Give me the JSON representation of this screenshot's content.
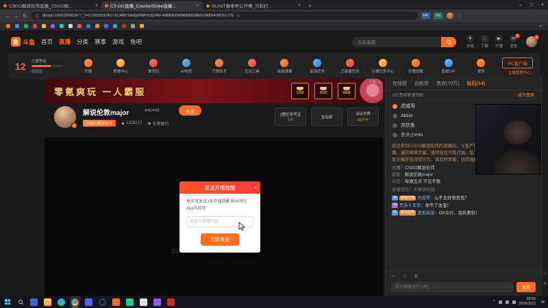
{
  "glyphs": {
    "close": "×",
    "minimize": "–",
    "maximize": "□",
    "new_tab": "+",
    "back": "←",
    "forward": "→",
    "refresh": "↻",
    "menu": "⋮",
    "star": "☆",
    "secure": "ⓘ",
    "more": "»",
    "chevron_up": "^",
    "gear": "⚙",
    "smile": "☺",
    "check": "✓",
    "diamond": "◆",
    "mail": "✉",
    "download": "↓",
    "yuan": "¥",
    "play": "▶",
    "dot": "●",
    "shield": "◉",
    "plus": "+"
  },
  "browser": {
    "tabs": [
      {
        "label": "CSGO解说伦伟直播_CSGO解…"
      },
      {
        "label": "CS:GO直播_CounterStrike直播…"
      },
      {
        "label": "BLAST春季杯公开赛_贝彩打…"
      }
    ],
    "url": "douyu.com/2938297?_r=0.55555324273134978&dyshid=532348-e9db83568edd325bdcc6dfa400051701",
    "ext1": "HK",
    "ext2": "5G"
  },
  "douyu": {
    "nav": {
      "logo_box": "鱼",
      "logo_text": "斗鱼",
      "items": [
        "首页",
        "直播",
        "分类",
        "赛事",
        "游戏",
        "鱼吧"
      ],
      "search_text": "去买蛋糕",
      "quick": [
        {
          "label": "充值"
        },
        {
          "label": "下载"
        },
        {
          "label": "开播"
        },
        {
          "label": "消息",
          "badge": "2"
        }
      ],
      "avatar_badge": "2"
    },
    "toolbar": {
      "level": "12",
      "level_label": "主播等级",
      "exp_label": "经验值",
      "items": [
        "开播",
        "数据中心",
        "推流码",
        "AI电竞",
        "刀塔助手",
        "互动工具",
        "高能弹幕",
        "星海任务",
        "正能量任务",
        "主播任务中心",
        "开播提醒",
        "鱼翅VIP",
        "更多"
      ],
      "pc_client": "PC客户端",
      "manage": "主播管理中心 ›"
    },
    "banner": {
      "slogan": "零氪爽玩 一人霸服",
      "ad_tag": "广告",
      "prices": [
        "1300",
        "4500",
        "8888"
      ]
    },
    "streamer": {
      "name": "解说伦敦major",
      "followers": "640449",
      "follow": "关注",
      "fan_badge": "CSGO解说伦伟",
      "room_id": "1326217",
      "tag": "无需解约",
      "task1_line1": "2图任务凭证",
      "task1_line2": "1/5",
      "horn": "全站晒",
      "trial_line1": "试玩世界",
      "trial_line2": "20分卡"
    },
    "video_hint": "您当前未开播，开播后这里将显示直播画面",
    "modal": {
      "title": "发送开播提醒",
      "desc": "每天可发送3条开播提醒,粉丝将在App内收到",
      "input_placeholder": "自定义提醒内容",
      "submit": "立即发送"
    },
    "sidebar": {
      "tabs": [
        "在线榜",
        "远航榜",
        "贵宾(70万)",
        "钻石(14)"
      ],
      "notice": "8位贵宾尊享特权",
      "notice_link": "成为贵宾",
      "users": [
        "虎威哥",
        "Aktus",
        "苏钦鱼",
        "东大小miu"
      ],
      "welcome": "欢迎来到CSGO解说伦伟的直播间，斗鱼严禁未成年人充值打赏。绿色直播，谨防网络诈骗，请勿轻信代练代抽、私下交易等信息，谨防上当受骗。如主播存在违规行为，请及时举报，共同维护健康直播环境。",
      "info_anchor_label": "主播：",
      "info_anchor": "CSGO解说伦伟",
      "info_admin_label": "房管：",
      "info_admin": "解说伦敦major",
      "info_notice_label": "公告：",
      "info_notice": "每晚五点 不见不散",
      "tip": "直播预告：不播倒垃圾",
      "messages": [
        {
          "level": "24",
          "fan": "解说伦伟",
          "name": "虎威哥：",
          "text": "心不太好意思找？"
        },
        {
          "level": "10",
          "name": "贵族十年斩：",
          "text": "你不了血宝！"
        },
        {
          "level": "21",
          "fan": "解说伦伟",
          "name": "酒鬼英雄：",
          "text": "OK众行，羽兵奥利！"
        }
      ],
      "input_placeholder": "和大家聊点什么吧…",
      "send": "发送"
    }
  },
  "taskbar": {
    "time": "18:56",
    "date": "2026/3/22"
  }
}
